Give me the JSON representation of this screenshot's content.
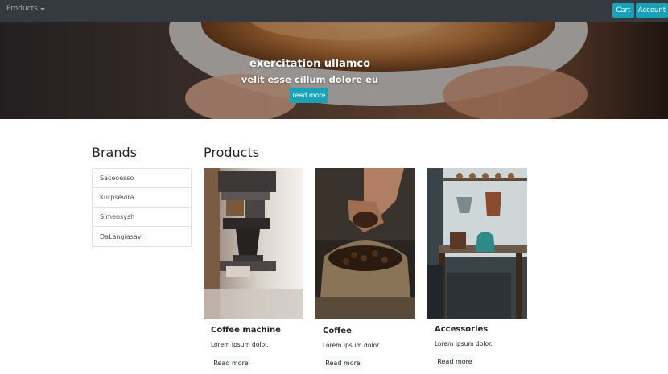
{
  "navbar": {
    "products_label": "Products",
    "cart_label": "Cart",
    "account_label": "Account"
  },
  "hero": {
    "title": "exercitation ullamco",
    "subtitle": "velit esse cillum dolore eu",
    "button_label": "read more"
  },
  "brands": {
    "heading": "Brands",
    "items": [
      "Saceoesso",
      "Kurpsevira",
      "Simensysh",
      "DaLangiasavi"
    ]
  },
  "products": {
    "heading": "Products",
    "cards": [
      {
        "title": "Coffee machine",
        "text": "Lorem ipsum dolor.",
        "button": "Read more"
      },
      {
        "title": "Coffee",
        "text": "Lorem ipsum dolor.",
        "button": "Read more"
      },
      {
        "title": "Accessories",
        "text": "Lorem ipsum dolor.",
        "button": "Read more"
      }
    ]
  },
  "colors": {
    "navbar": "#343a40",
    "accent": "#17a2b8",
    "light_button": "#f8f9fa",
    "border": "#dee2e6"
  }
}
